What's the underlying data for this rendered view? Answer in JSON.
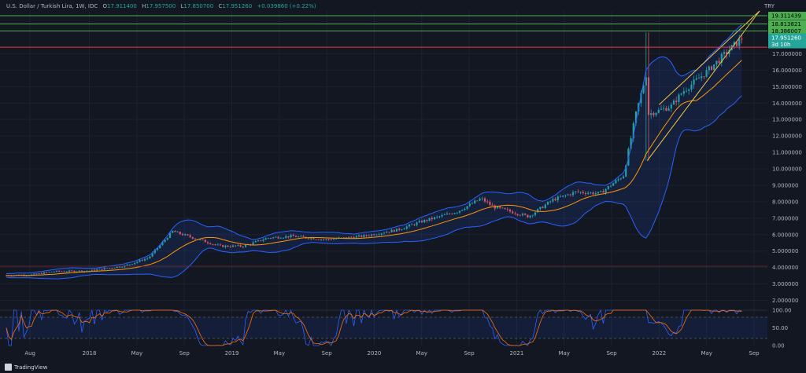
{
  "header": {
    "symbol": "U.S. Dollar / Turkish Lira, 1W, IDC",
    "open_label": "O",
    "open": "17.911400",
    "high_label": "H",
    "high": "17.957500",
    "low_label": "L",
    "low": "17.850700",
    "close_label": "C",
    "close": "17.951260",
    "change": "+0.039860 (+0.22%)"
  },
  "currency": "TRY",
  "brand": "TradingView",
  "price_labels": {
    "green_1": "19.311439",
    "green_2": "18.813821",
    "green_3": "18.386007",
    "last_price": "17.951260",
    "countdown": "3d 10h"
  },
  "colors": {
    "background": "#131722",
    "up": "#26a69a",
    "down": "#ef5350",
    "bollinger": "#2962ff",
    "ma": "#ff9800",
    "wedge": "#f5c542",
    "level_green": "#4caf50",
    "level_red": "#f23645",
    "stoch_k": "#2962ff",
    "stoch_d": "#ff6d00"
  },
  "chart_data": {
    "type": "candlestick",
    "title": "U.S. Dollar / Turkish Lira, 1W, IDC",
    "x_tick_labels": [
      "Aug",
      "2018",
      "May",
      "Sep",
      "2019",
      "May",
      "Sep",
      "2020",
      "May",
      "Sep",
      "2021",
      "May",
      "Sep",
      "2022",
      "May",
      "Sep"
    ],
    "y_tick_labels": [
      "2.000000",
      "3.000000",
      "4.000000",
      "5.000000",
      "6.000000",
      "7.000000",
      "8.000000",
      "9.000000",
      "10.000000",
      "11.000000",
      "12.000000",
      "13.000000",
      "14.000000",
      "15.000000",
      "16.000000",
      "17.000000"
    ],
    "ylim": [
      1.5,
      19.6
    ],
    "horizontal_levels": [
      {
        "value": 19.311439,
        "color": "green"
      },
      {
        "value": 18.813821,
        "color": "green"
      },
      {
        "value": 18.386007,
        "color": "green"
      },
      {
        "value": 17.4,
        "color": "red"
      }
    ],
    "close_series": [
      {
        "date": "2017-06",
        "close": 3.52
      },
      {
        "date": "2017-08",
        "close": 3.55
      },
      {
        "date": "2017-10",
        "close": 3.75
      },
      {
        "date": "2018-01",
        "close": 3.8
      },
      {
        "date": "2018-04",
        "close": 4.1
      },
      {
        "date": "2018-06",
        "close": 4.6
      },
      {
        "date": "2018-08",
        "close": 6.2
      },
      {
        "date": "2018-10",
        "close": 5.75
      },
      {
        "date": "2018-12",
        "close": 5.3
      },
      {
        "date": "2019-02",
        "close": 5.3
      },
      {
        "date": "2019-04",
        "close": 5.8
      },
      {
        "date": "2019-06",
        "close": 5.9
      },
      {
        "date": "2019-09",
        "close": 5.7
      },
      {
        "date": "2019-12",
        "close": 5.9
      },
      {
        "date": "2020-03",
        "close": 6.3
      },
      {
        "date": "2020-05",
        "close": 6.8
      },
      {
        "date": "2020-08",
        "close": 7.4
      },
      {
        "date": "2020-10",
        "close": 8.2
      },
      {
        "date": "2020-11",
        "close": 7.7
      },
      {
        "date": "2021-02",
        "close": 7.1
      },
      {
        "date": "2021-04",
        "close": 8.1
      },
      {
        "date": "2021-06",
        "close": 8.6
      },
      {
        "date": "2021-08",
        "close": 8.5
      },
      {
        "date": "2021-10",
        "close": 9.6
      },
      {
        "date": "2021-11",
        "close": 13.2
      },
      {
        "date": "2021-12",
        "close": 16.0
      },
      {
        "date": "2021-12",
        "close": 13.3
      },
      {
        "date": "2022-02",
        "close": 13.8
      },
      {
        "date": "2022-03",
        "close": 14.7
      },
      {
        "date": "2022-05",
        "close": 15.9
      },
      {
        "date": "2022-07",
        "close": 17.3
      },
      {
        "date": "2022-08",
        "close": 17.95126
      }
    ],
    "stochastic": {
      "y_tick_labels": [
        "100.00",
        "50.00",
        "0.00"
      ],
      "upper_band": 80,
      "lower_band": 20
    }
  }
}
